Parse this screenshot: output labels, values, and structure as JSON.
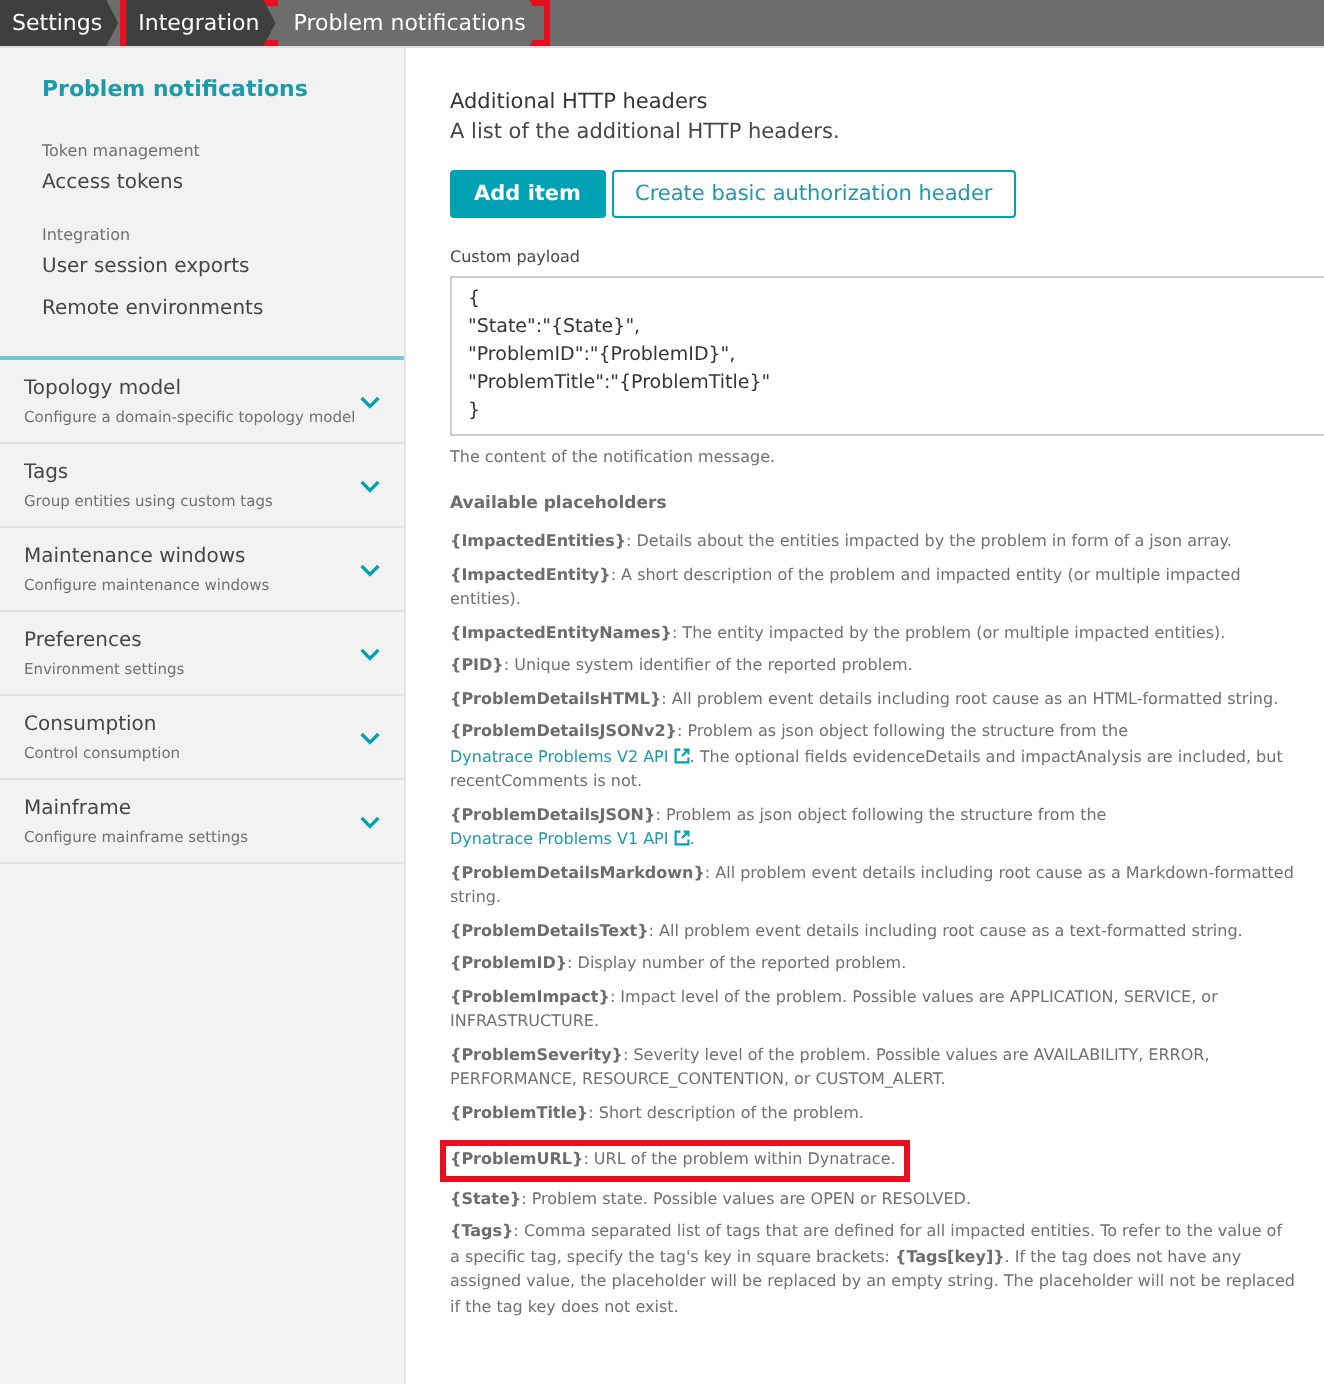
{
  "breadcrumb": [
    {
      "label": "Settings",
      "highlighted": false
    },
    {
      "label": "Integration",
      "highlighted": true
    },
    {
      "label": "Problem notifications",
      "highlighted": true
    }
  ],
  "sidebar": {
    "current": "Problem notifications",
    "groups": [
      {
        "label": "Token management",
        "items": [
          "Access tokens"
        ]
      },
      {
        "label": "Integration",
        "items": [
          "User session exports",
          "Remote environments"
        ]
      }
    ],
    "sections": [
      {
        "title": "Topology model",
        "subtitle": "Configure a domain-specific topology model",
        "expanded": false
      },
      {
        "title": "Tags",
        "subtitle": "Group entities using custom tags",
        "expanded": false
      },
      {
        "title": "Maintenance windows",
        "subtitle": "Configure maintenance windows",
        "expanded": false
      },
      {
        "title": "Preferences",
        "subtitle": "Environment settings",
        "expanded": false
      },
      {
        "title": "Consumption",
        "subtitle": "Control consumption",
        "expanded": false
      },
      {
        "title": "Mainframe",
        "subtitle": "Configure mainframe settings",
        "expanded": false
      }
    ]
  },
  "headers": {
    "title": "Additional HTTP headers",
    "description": "A list of the additional HTTP headers.",
    "buttons": [
      {
        "label": "Add item",
        "kind": "primary"
      },
      {
        "label": "Create basic authorization header",
        "kind": "secondary"
      }
    ]
  },
  "payload": {
    "label": "Custom payload",
    "lines": [
      "{",
      "\"State\":\"{State}\",",
      "\"ProblemID\":\"{ProblemID}\",",
      "\"ProblemTitle\":\"{ProblemTitle}\"",
      "}"
    ],
    "hint": "The content of the notification message."
  },
  "placeholders": {
    "title": "Available placeholders",
    "items": [
      {
        "name": "{ImpactedEntities}",
        "highlighted": false,
        "segments": [
          {
            "kind": "text",
            "text": ": Details about the entities impacted by the problem in form of a json array."
          }
        ]
      },
      {
        "name": "{ImpactedEntity}",
        "highlighted": false,
        "segments": [
          {
            "kind": "text",
            "text": ": A short description of the problem and impacted entity (or multiple impacted entities)."
          }
        ]
      },
      {
        "name": "{ImpactedEntityNames}",
        "highlighted": false,
        "segments": [
          {
            "kind": "text",
            "text": ": The entity impacted by the problem (or multiple impacted entities)."
          }
        ]
      },
      {
        "name": "{PID}",
        "highlighted": false,
        "segments": [
          {
            "kind": "text",
            "text": ": Unique system identifier of the reported problem."
          }
        ]
      },
      {
        "name": "{ProblemDetailsHTML}",
        "highlighted": false,
        "segments": [
          {
            "kind": "text",
            "text": ": All problem event details including root cause as an HTML-formatted string."
          }
        ]
      },
      {
        "name": "{ProblemDetailsJSONv2}",
        "highlighted": false,
        "segments": [
          {
            "kind": "text",
            "text": ": Problem as json object following the structure from the "
          },
          {
            "kind": "link",
            "text": "Dynatrace Problems V2 API"
          },
          {
            "kind": "text",
            "text": ". The optional fields evidenceDetails and impactAnalysis are included, but recentComments is not."
          }
        ]
      },
      {
        "name": "{ProblemDetailsJSON}",
        "highlighted": false,
        "segments": [
          {
            "kind": "text",
            "text": ": Problem as json object following the structure from the "
          },
          {
            "kind": "link",
            "text": "Dynatrace Problems V1 API"
          },
          {
            "kind": "text",
            "text": "."
          }
        ]
      },
      {
        "name": "{ProblemDetailsMarkdown}",
        "highlighted": false,
        "segments": [
          {
            "kind": "text",
            "text": ": All problem event details including root cause as a Markdown-formatted string."
          }
        ]
      },
      {
        "name": "{ProblemDetailsText}",
        "highlighted": false,
        "segments": [
          {
            "kind": "text",
            "text": ": All problem event details including root cause as a text-formatted string."
          }
        ]
      },
      {
        "name": "{ProblemID}",
        "highlighted": false,
        "segments": [
          {
            "kind": "text",
            "text": ": Display number of the reported problem."
          }
        ]
      },
      {
        "name": "{ProblemImpact}",
        "highlighted": false,
        "segments": [
          {
            "kind": "text",
            "text": ": Impact level of the problem. Possible values are APPLICATION, SERVICE, or INFRASTRUCTURE."
          }
        ]
      },
      {
        "name": "{ProblemSeverity}",
        "highlighted": false,
        "segments": [
          {
            "kind": "text",
            "text": ": Severity level of the problem. Possible values are AVAILABILITY, ERROR, PERFORMANCE, RESOURCE_CONTENTION, or CUSTOM_ALERT."
          }
        ]
      },
      {
        "name": "{ProblemTitle}",
        "highlighted": false,
        "segments": [
          {
            "kind": "text",
            "text": ": Short description of the problem."
          }
        ]
      },
      {
        "name": "{ProblemURL}",
        "highlighted": true,
        "segments": [
          {
            "kind": "text",
            "text": ": URL of the problem within Dynatrace."
          }
        ]
      },
      {
        "name": "{State}",
        "highlighted": false,
        "segments": [
          {
            "kind": "text",
            "text": ": Problem state. Possible values are OPEN or RESOLVED."
          }
        ]
      },
      {
        "name": "{Tags}",
        "highlighted": false,
        "segments": [
          {
            "kind": "text",
            "text": ": Comma separated list of tags that are defined for all impacted entities. To refer to the value of a specific tag, specify the tag's key in square brackets: **{Tags[key]}**. If the tag does not have any assigned value, the placeholder will be replaced by an empty string. The placeholder will not be replaced if the tag key does not exist."
          }
        ]
      }
    ]
  }
}
